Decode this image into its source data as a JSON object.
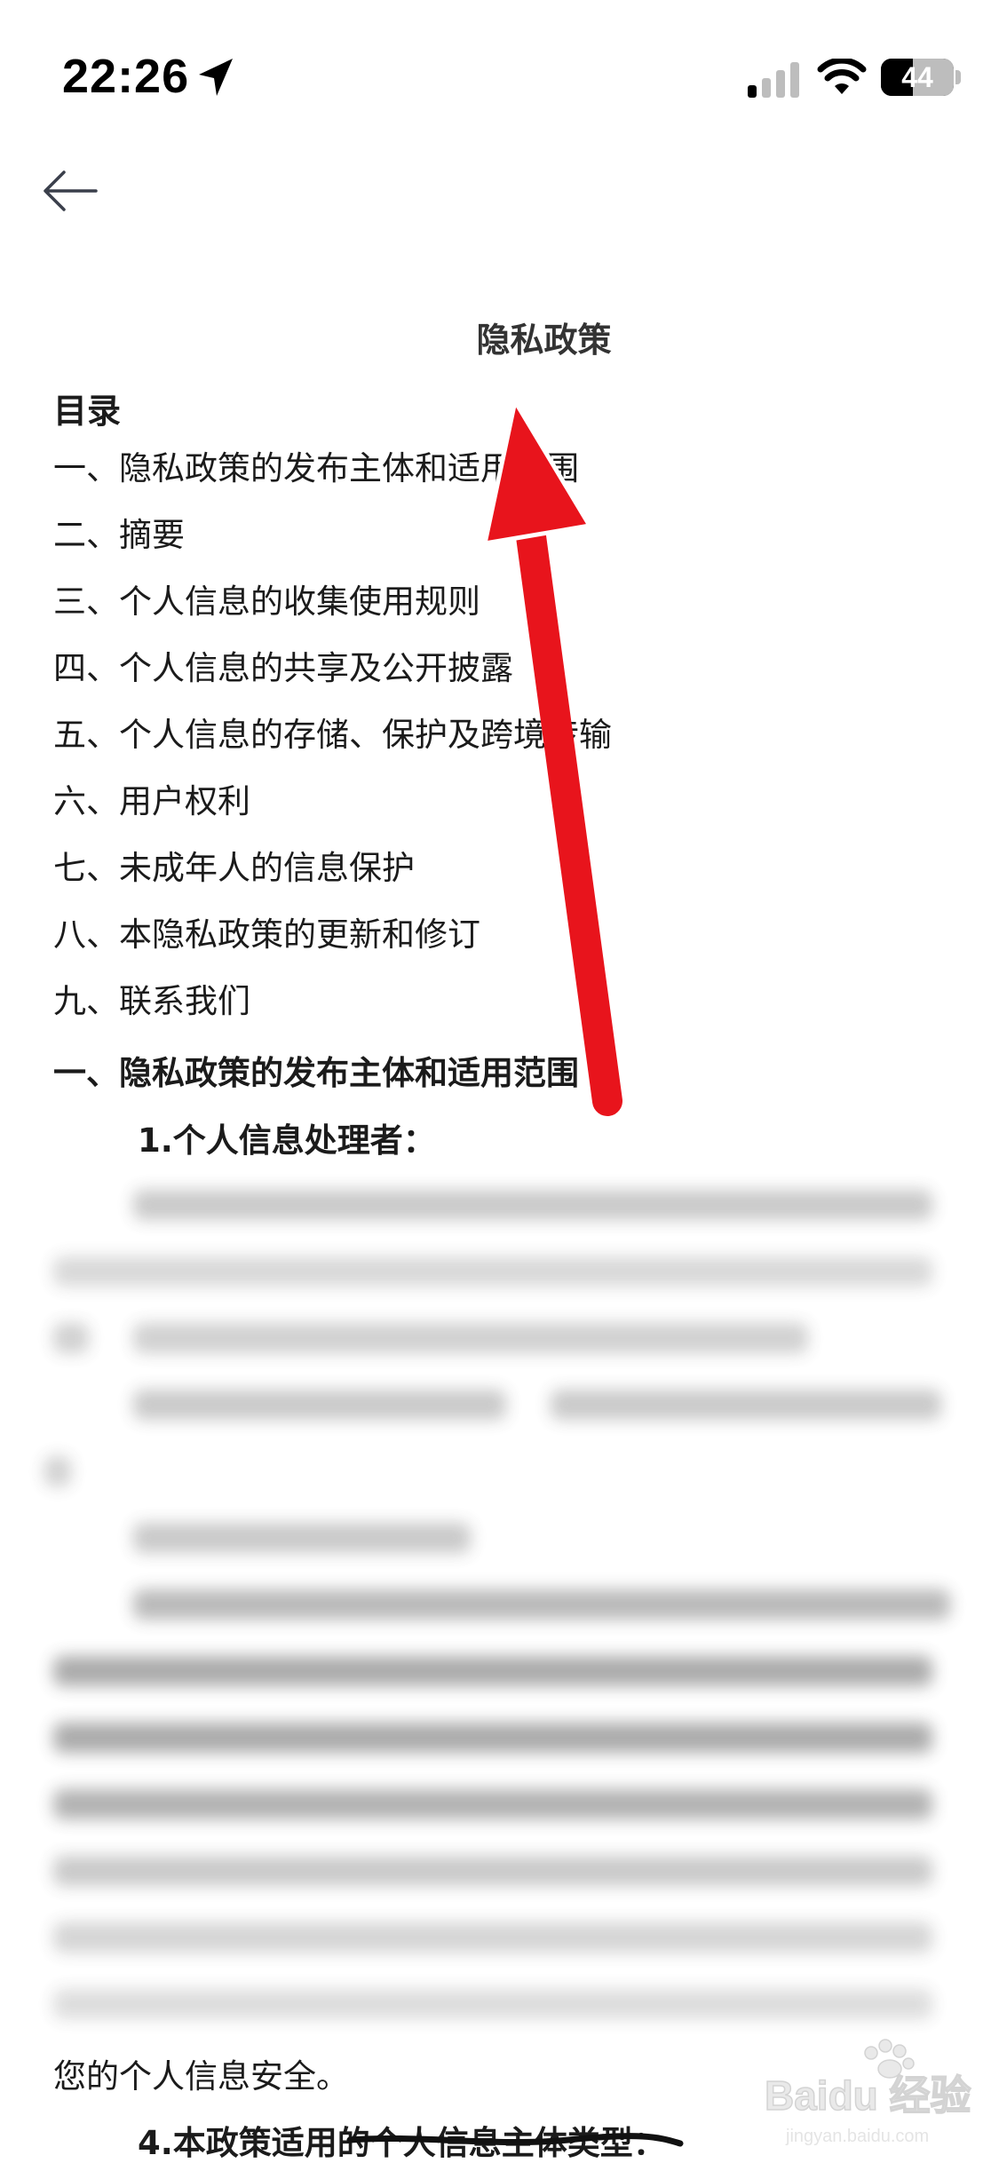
{
  "status_bar": {
    "time": "22:26",
    "battery_level": "44",
    "battery_fraction": 0.44
  },
  "nav": {
    "back_icon": "arrow-left-icon"
  },
  "document": {
    "title": "隐私政策",
    "toc_heading": "目录",
    "toc_items": [
      "一、隐私政策的发布主体和适用范围",
      "二、摘要",
      "三、个人信息的收集使用规则",
      "四、个人信息的共享及公开披露",
      "五、个人信息的存储、保护及跨境传输",
      "六、用户权利",
      "七、未成年人的信息保护",
      "八、本隐私政策的更新和修订",
      "九、联系我们"
    ],
    "section_1_heading": "一、隐私政策的发布主体和适用范围",
    "subsection_1_heading": "1.个人信息处理者：",
    "tail_text": "您的个人信息安全。",
    "subsection_4_heading": "4.本政策适用的个人信息主体类型："
  },
  "annotation": {
    "arrow_color": "#e8141c",
    "arrow_direction": "up"
  },
  "watermark": {
    "brand": "Baidu 经验",
    "site": "jingyan.baidu.com"
  }
}
